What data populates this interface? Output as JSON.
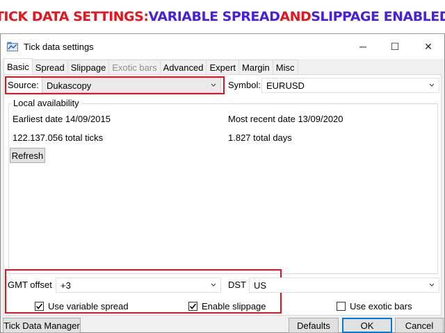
{
  "banner": {
    "part1": "TICK DATA SETTINGS: ",
    "part2": "VARIABLE SPREAD",
    "part3": " AND ",
    "part4": "SLIPPAGE ENABLED",
    "colors": {
      "red": "#e8141e",
      "blue": "#4b1fe0"
    }
  },
  "window": {
    "title": "Tick data settings",
    "controls": {
      "minimize": "─",
      "maximize": "☐",
      "close": "✕"
    }
  },
  "tabs": [
    {
      "label": "Basic",
      "state": "active"
    },
    {
      "label": "Spread",
      "state": "normal"
    },
    {
      "label": "Slippage",
      "state": "normal"
    },
    {
      "label": "Exotic bars",
      "state": "disabled"
    },
    {
      "label": "Advanced",
      "state": "normal"
    },
    {
      "label": "Expert",
      "state": "normal"
    },
    {
      "label": "Margin",
      "state": "normal"
    },
    {
      "label": "Misc",
      "state": "normal"
    }
  ],
  "source": {
    "label": "Source:",
    "value": "Dukascopy"
  },
  "symbol": {
    "label": "Symbol:",
    "value": "EURUSD"
  },
  "local_availability": {
    "title": "Local availability",
    "earliest_date": "Earliest date 14/09/2015",
    "most_recent_date": "Most recent date 13/09/2020",
    "total_ticks": "122.137.056 total ticks",
    "total_days": "1.827 total days",
    "refresh_label": "Refresh"
  },
  "gmt_offset": {
    "label": "GMT offset",
    "value": "+3"
  },
  "dst": {
    "label": "DST",
    "value": "US"
  },
  "checkboxes": {
    "variable_spread": {
      "label": "Use variable spread",
      "checked": true
    },
    "enable_slippage": {
      "label": "Enable slippage",
      "checked": true
    },
    "exotic_bars": {
      "label": "Use exotic bars",
      "checked": false
    }
  },
  "footer": {
    "manager_label": "Tick Data Manager",
    "defaults_label": "Defaults",
    "ok_label": "OK",
    "cancel_label": "Cancel"
  },
  "highlight_color": "#e5131b",
  "icons": {
    "app": "chart-app-icon",
    "dropdown": "chevron-down-icon",
    "check": "checkmark-icon"
  }
}
